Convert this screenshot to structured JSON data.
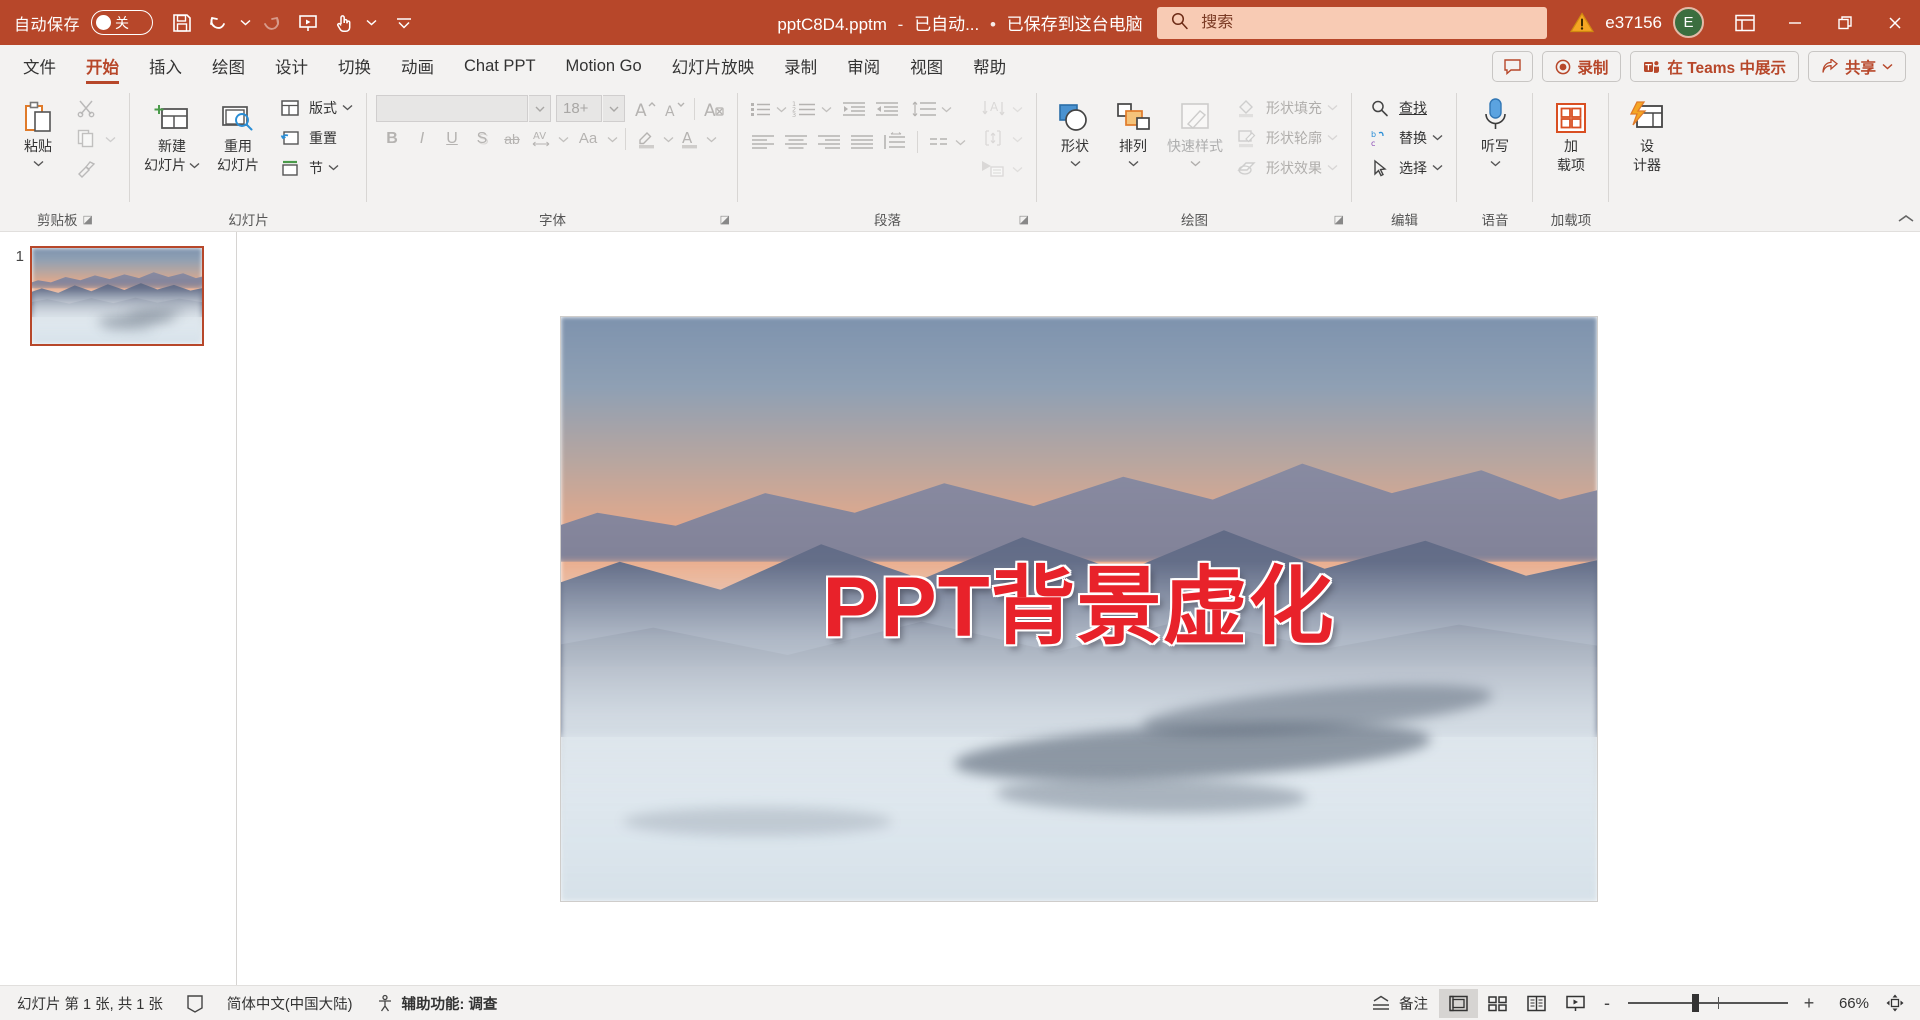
{
  "titlebar": {
    "autosave_label": "自动保存",
    "autosave_state": "关",
    "doc_title": "pptC8D4.pptm",
    "doc_dash": "-",
    "doc_status": "已自动...",
    "doc_bullet": "•",
    "doc_saved": "已保存到这台电脑",
    "search_placeholder": "搜索",
    "user_name": "e37156",
    "avatar_initial": "E",
    "accent_color": "#b7472a",
    "search_bg": "#f8cbb4",
    "qat": [
      {
        "name": "save-icon",
        "label": "保存"
      },
      {
        "name": "undo-icon",
        "label": "撤消"
      },
      {
        "name": "redo-icon",
        "label": "重复"
      },
      {
        "name": "start-slideshow-icon",
        "label": "从头开始"
      },
      {
        "name": "touch-mode-icon",
        "label": "触摸/鼠标模式"
      },
      {
        "name": "customize-qat-icon",
        "label": "自定义快速访问工具栏"
      }
    ],
    "window_controls": [
      {
        "name": "minimize-button",
        "glyph": "—"
      },
      {
        "name": "restore-button",
        "glyph": "❐"
      },
      {
        "name": "close-button",
        "glyph": "✕"
      }
    ]
  },
  "tabs": [
    {
      "label": "文件",
      "active": false
    },
    {
      "label": "开始",
      "active": true
    },
    {
      "label": "插入",
      "active": false
    },
    {
      "label": "绘图",
      "active": false
    },
    {
      "label": "设计",
      "active": false
    },
    {
      "label": "切换",
      "active": false
    },
    {
      "label": "动画",
      "active": false
    },
    {
      "label": "Chat PPT",
      "active": false
    },
    {
      "label": "Motion Go",
      "active": false
    },
    {
      "label": "幻灯片放映",
      "active": false
    },
    {
      "label": "录制",
      "active": false
    },
    {
      "label": "审阅",
      "active": false
    },
    {
      "label": "视图",
      "active": false
    },
    {
      "label": "帮助",
      "active": false
    }
  ],
  "tab_actions": {
    "comment_label": "批注",
    "record_label": "录制",
    "teams_label": "在 Teams 中展示",
    "share_label": "共享"
  },
  "ribbon": {
    "groups": [
      {
        "label": "剪贴板",
        "has_dialog_launcher": true
      },
      {
        "label": "幻灯片",
        "has_dialog_launcher": false
      },
      {
        "label": "字体",
        "has_dialog_launcher": true
      },
      {
        "label": "段落",
        "has_dialog_launcher": true
      },
      {
        "label": "绘图",
        "has_dialog_launcher": true
      },
      {
        "label": "编辑",
        "has_dialog_launcher": false
      },
      {
        "label": "语音",
        "has_dialog_launcher": false
      },
      {
        "label": "加载项",
        "has_dialog_launcher": false
      }
    ],
    "clipboard": {
      "paste_label": "粘贴",
      "cut_label": "剪切",
      "copy_label": "复制",
      "format_painter_label": "格式刷"
    },
    "slides": {
      "new_slide_l1": "新建",
      "new_slide_l2": "幻灯片",
      "reuse_l1": "重用",
      "reuse_l2": "幻灯片",
      "layout_label": "版式",
      "reset_label": "重置",
      "section_label": "节"
    },
    "font": {
      "font_name_value": "",
      "font_size_value": "18+",
      "grow_label": "增大字号",
      "shrink_label": "减小字号",
      "clear_format_label": "清除所有格式",
      "bold_label": "B",
      "italic_label": "I",
      "underline_label": "U",
      "shadow_label": "S",
      "strike_label": "ab",
      "spacing_label": "AV",
      "case_label": "Aa",
      "highlight_label": "文本突出显示颜色",
      "fontcolor_label": "字体颜色",
      "disabled": true
    },
    "paragraph": {
      "bullets_label": "项目符号",
      "numbering_label": "编号",
      "dec_indent_label": "减少缩进量",
      "inc_indent_label": "增加缩进量",
      "line_spacing_label": "行距",
      "text_direction_label": "文字方向",
      "align_text_label": "对齐文本",
      "smartart_label": "转换为 SmartArt",
      "align_left_label": "左对齐",
      "align_center_label": "居中",
      "align_right_label": "右对齐",
      "justify_label": "两端对齐",
      "columns_label": "分栏",
      "disabled": true
    },
    "drawing": {
      "shapes_label": "形状",
      "arrange_label": "排列",
      "quick_styles_label": "快速样式",
      "shape_fill_label": "形状填充",
      "shape_outline_label": "形状轮廓",
      "shape_effects_label": "形状效果"
    },
    "editing": {
      "find_label": "查找",
      "replace_label": "替换",
      "select_label": "选择"
    },
    "voice": {
      "dictate_l1": "听写"
    },
    "addins": {
      "addins_l1": "加",
      "addins_l2": "载项"
    },
    "designer": {
      "designer_l1": "设",
      "designer_l2": "计器"
    },
    "collapse_label": "折叠功能区"
  },
  "thumbnails": [
    {
      "number": "1",
      "selected": true
    }
  ],
  "slide": {
    "title_text": "PPT背景虚化",
    "title_color": "#e8222a"
  },
  "statusbar": {
    "slide_count_text": "幻灯片 第 1 张, 共 1 张",
    "notes_check_label": "拼写检查",
    "language": "简体中文(中国大陆)",
    "accessibility": "辅助功能: 调查",
    "notes_label": "备注",
    "views": [
      {
        "name": "normal-view-button",
        "label": "普通视图",
        "active": true
      },
      {
        "name": "slide-sorter-button",
        "label": "幻灯片浏览",
        "active": false
      },
      {
        "name": "reading-view-button",
        "label": "阅读视图",
        "active": false
      },
      {
        "name": "slideshow-button",
        "label": "幻灯片放映",
        "active": false
      }
    ],
    "zoom_out_label": "-",
    "zoom_in_label": "+",
    "zoom_value": "66%",
    "fit_label": "使幻灯片适应当前窗口"
  }
}
